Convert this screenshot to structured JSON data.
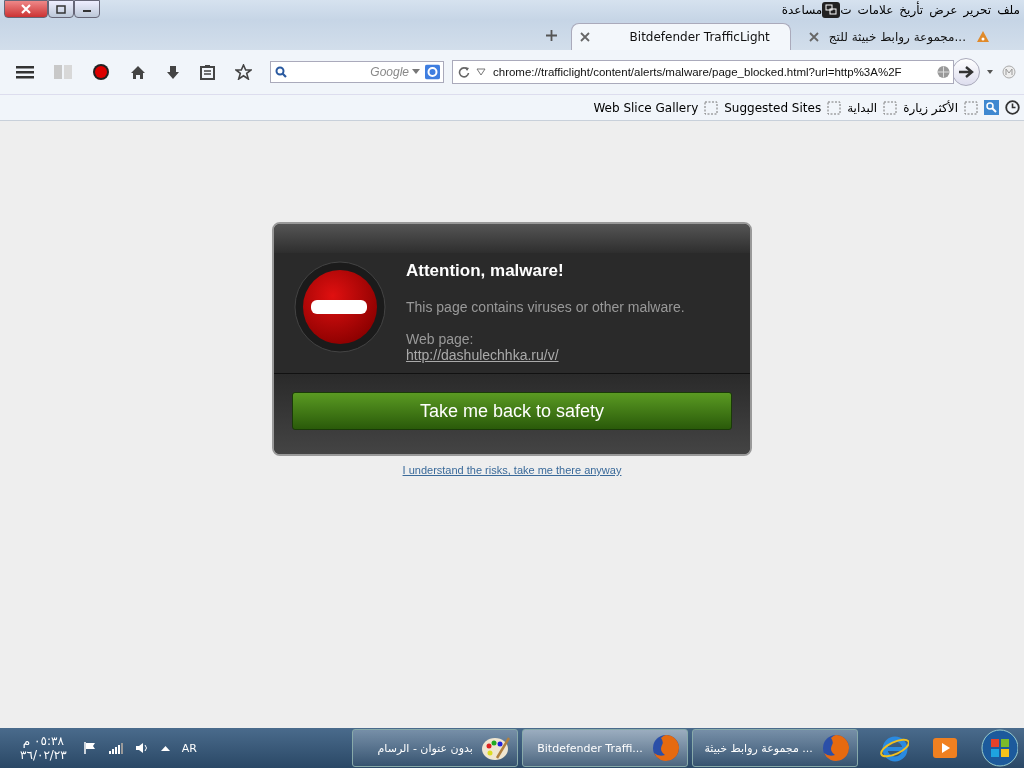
{
  "menu": [
    {
      "label": "ملف"
    },
    {
      "label": "تحرير"
    },
    {
      "label": "عرض"
    },
    {
      "label": "تأريخ"
    },
    {
      "label": "علامات"
    },
    {
      "label": "ت",
      "covered": true
    },
    {
      "label": "مساعدة"
    }
  ],
  "tabs": [
    {
      "label": "مجموعة روابط خبيثة للتج...",
      "selected": false
    },
    {
      "label": "Bitdefender TrafficLight",
      "selected": true
    }
  ],
  "search": {
    "placeholder": "Google"
  },
  "address": {
    "value": "chrome://trafficlight/content/alerts/malware/page_blocked.html?url=http%3A%2F"
  },
  "bookmarks": [
    {
      "label": "الأكثر زيارة"
    },
    {
      "label": "البداية"
    },
    {
      "label": "Suggested Sites"
    },
    {
      "label": "Web Slice Gallery"
    }
  ],
  "alert": {
    "title": "Attention, malware!",
    "message": "This page contains viruses or other malware.",
    "page_label": "Web page:",
    "page_url": "http://dashulechhka.ru/v/",
    "button": "Take me back to safety",
    "bypass_link": "I understand the risks, take me there anyway"
  },
  "taskbar": {
    "tasks": [
      {
        "label": "مجموعة روابط خبيثة ...",
        "kind": "firefox",
        "selected": false
      },
      {
        "label": "Bitdefender Traffi...",
        "kind": "firefox",
        "selected": true
      },
      {
        "label": "بدون عنوان - الرسام",
        "kind": "paint",
        "selected": false
      }
    ],
    "language": "AR",
    "time": "٠٥:٣٨ م",
    "date": "٣٦/٠٢/٢٣"
  }
}
